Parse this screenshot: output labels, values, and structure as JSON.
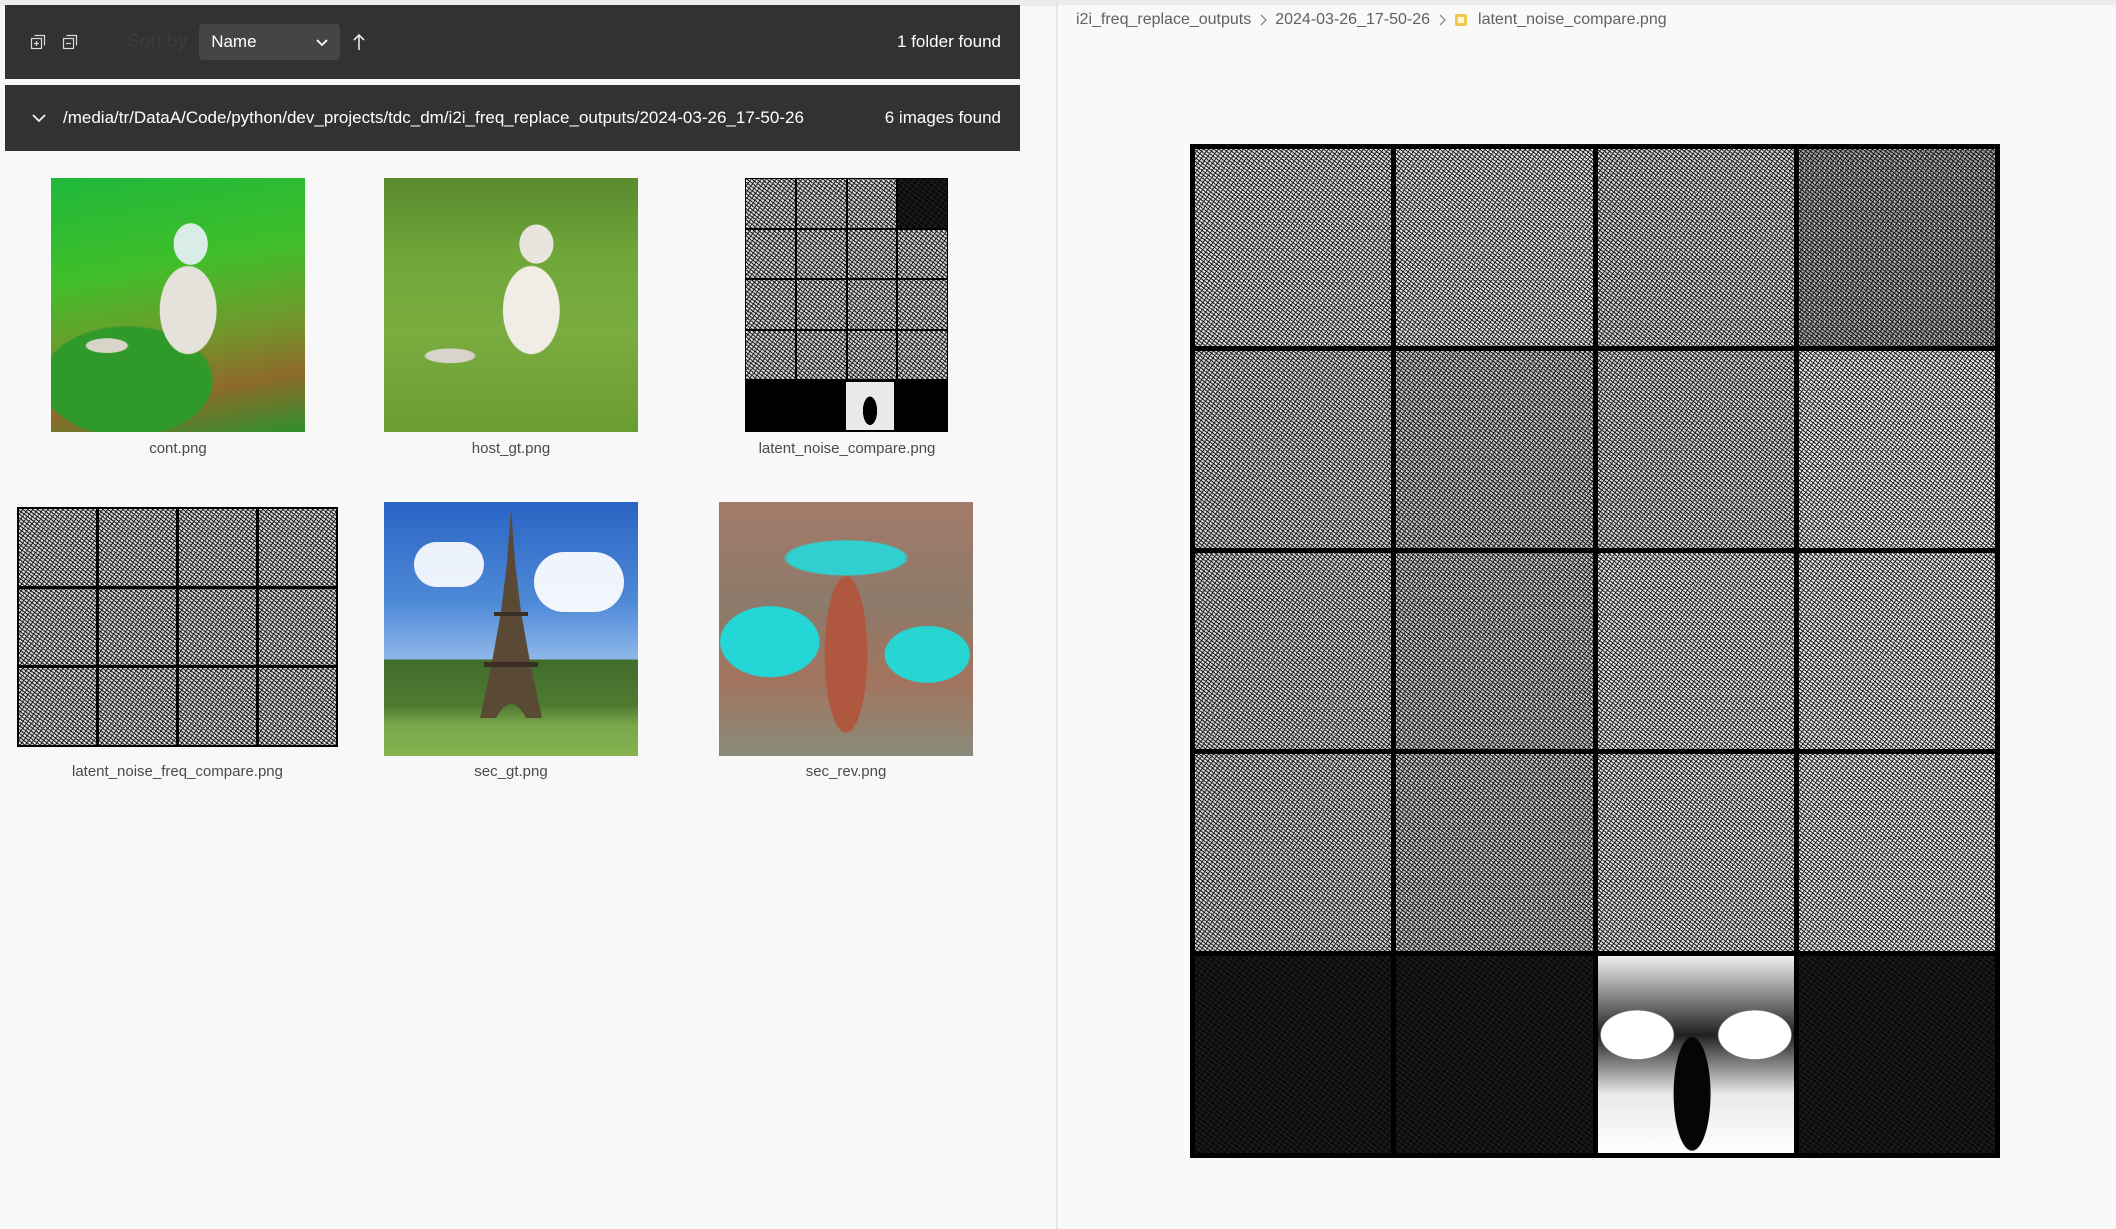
{
  "toolbar": {
    "sort_label": "Sort by",
    "sort_value": "Name",
    "folder_count": "1 folder found",
    "icons": [
      "expand-all-icon",
      "collapse-all-icon",
      "chevron-down-icon",
      "sort-ascending-icon"
    ]
  },
  "folder": {
    "path": "/media/tr/DataA/Code/python/dev_projects/tdc_dm/i2i_freq_replace_outputs/2024-03-26_17-50-26",
    "image_count": "6 images found"
  },
  "images": [
    {
      "name": "cont.png"
    },
    {
      "name": "host_gt.png"
    },
    {
      "name": "latent_noise_compare.png"
    },
    {
      "name": "latent_noise_freq_compare.png"
    },
    {
      "name": "sec_gt.png"
    },
    {
      "name": "sec_rev.png"
    }
  ],
  "breadcrumb": {
    "folder": "i2i_freq_replace_outputs",
    "subfolder": "2024-03-26_17-50-26",
    "file": "latent_noise_compare.png"
  },
  "colors": {
    "panel_dark": "#323232",
    "select_bg": "#454545",
    "background": "#f8f8f8",
    "file_icon": "#f2c94c"
  }
}
